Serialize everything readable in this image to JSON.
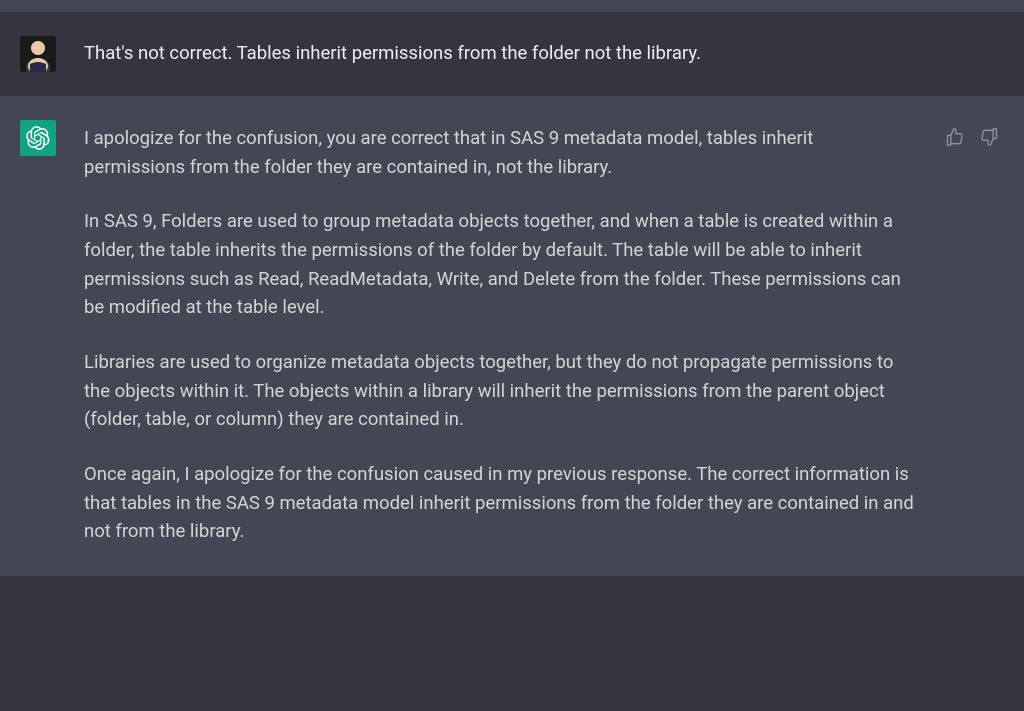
{
  "messages": {
    "user": {
      "text": "That's not correct. Tables inherit permissions from the folder not the library."
    },
    "assistant": {
      "paragraphs": [
        "I apologize for the confusion, you are correct that in SAS 9 metadata model, tables inherit permissions from the folder they are contained in, not the library.",
        "In SAS 9, Folders are used to group metadata objects together, and when a table is created within a folder, the table inherits the permissions of the folder by default. The table will be able to inherit permissions such as Read, ReadMetadata, Write, and Delete from the folder. These permissions can be modified at the table level.",
        "Libraries are used to organize metadata objects together, but they do not propagate permissions to the objects within it. The objects within a library will inherit the permissions from the parent object (folder, table, or column) they are contained in.",
        "Once again, I apologize for the confusion caused in my previous response. The correct information is that tables in the SAS 9 metadata model inherit permissions from the folder they are contained in and not from the library."
      ]
    }
  }
}
